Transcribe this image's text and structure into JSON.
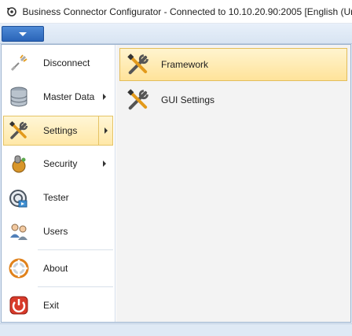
{
  "window": {
    "title": "Business Connector Configurator - Connected to 10.10.20.90:2005 [English (Unit",
    "app_icon": "refresh-gear-icon"
  },
  "ribbon": {
    "app_menu_button_icon": "chevron-down-icon",
    "accent_color": "#2a64b8"
  },
  "left_menu": {
    "items": [
      {
        "label": "Disconnect",
        "icon": "disconnect-icon"
      },
      {
        "label": "Master Data",
        "icon": "database-icon",
        "has_submenu": true
      },
      {
        "label": "Settings",
        "icon": "tools-icon",
        "has_submenu": true,
        "selected": true
      },
      {
        "label": "Security",
        "icon": "security-icon",
        "has_submenu": true
      },
      {
        "label": "Tester",
        "icon": "tester-icon"
      },
      {
        "label": "Users",
        "icon": "users-icon"
      },
      {
        "label": "About",
        "icon": "about-icon"
      },
      {
        "label": "Exit",
        "icon": "exit-icon"
      }
    ]
  },
  "submenu": {
    "items": [
      {
        "label": "Framework",
        "icon": "tools-icon",
        "selected": true
      },
      {
        "label": "GUI Settings",
        "icon": "tools-icon"
      }
    ]
  },
  "colors": {
    "highlight": "#ffe8a8",
    "highlight_border": "#e5c365"
  }
}
